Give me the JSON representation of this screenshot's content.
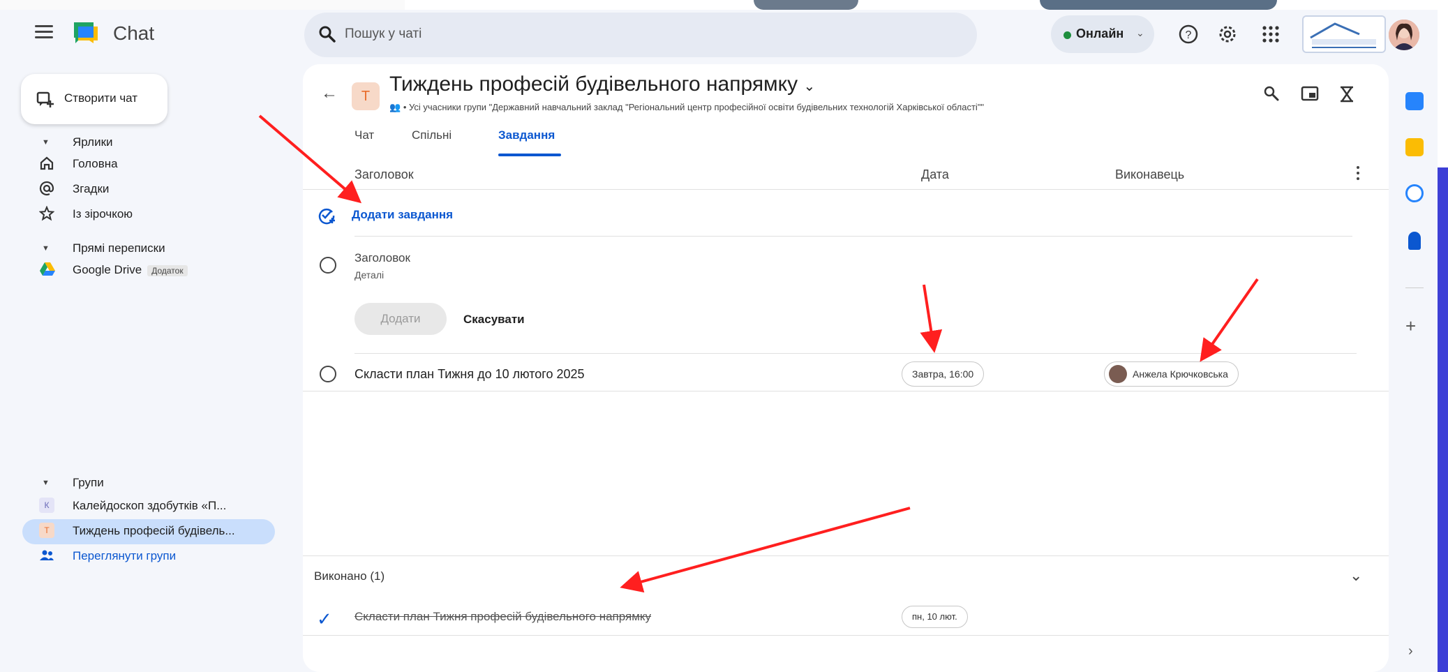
{
  "app": {
    "title": "Chat"
  },
  "search": {
    "placeholder": "Пошук у чаті"
  },
  "status": {
    "label": "Онлайн",
    "color": "#1e8e3e"
  },
  "sidebar": {
    "create_label": "Створити чат",
    "labels_section": "Ярлики",
    "items": [
      {
        "label": "Головна",
        "icon": "home-icon"
      },
      {
        "label": "Згадки",
        "icon": "at-icon"
      },
      {
        "label": "Із зірочкою",
        "icon": "star-icon"
      }
    ],
    "direct_section": "Прямі переписки",
    "direct_items": [
      {
        "label": "Google Drive",
        "tag": "Додаток",
        "icon": "google-drive-icon"
      }
    ],
    "groups_section": "Групи",
    "groups": [
      {
        "label": "Калейдоскоп здобутків «П...",
        "badge": "К"
      },
      {
        "label": "Тиждень професій будівель...",
        "badge": "Т"
      }
    ],
    "browse_label": "Переглянути групи"
  },
  "space": {
    "avatar_letter": "Т",
    "title": "Тиждень професій будівельного напрямку",
    "subtitle": "• Усі учасники групи \"Державний навчальний заклад \"Регіональний центр професійної освіти будівельних технологій Харківської області\"\""
  },
  "tabs": [
    {
      "label": "Чат"
    },
    {
      "label": "Спільні"
    },
    {
      "label": "Завдання"
    }
  ],
  "table": {
    "col_title": "Заголовок",
    "col_date": "Дата",
    "col_assignee": "Виконавець"
  },
  "add_task_label": "Додати завдання",
  "new_task": {
    "title_placeholder": "Заголовок",
    "details_placeholder": "Деталі",
    "add_button": "Додати",
    "cancel_button": "Скасувати"
  },
  "tasks": [
    {
      "title": "Скласти план Тижня до 10 лютого 2025",
      "date": "Завтра, 16:00",
      "assignee": "Анжела Крючковська"
    }
  ],
  "completed": {
    "header": "Виконано (1)",
    "items": [
      {
        "title": "Скласти план Тижня професій будівельного напрямку",
        "date": "пн, 10 лют."
      }
    ]
  },
  "colors": {
    "accent": "#0b57d0",
    "arrow": "#ff1f1f",
    "background": "#3d3fd6"
  }
}
